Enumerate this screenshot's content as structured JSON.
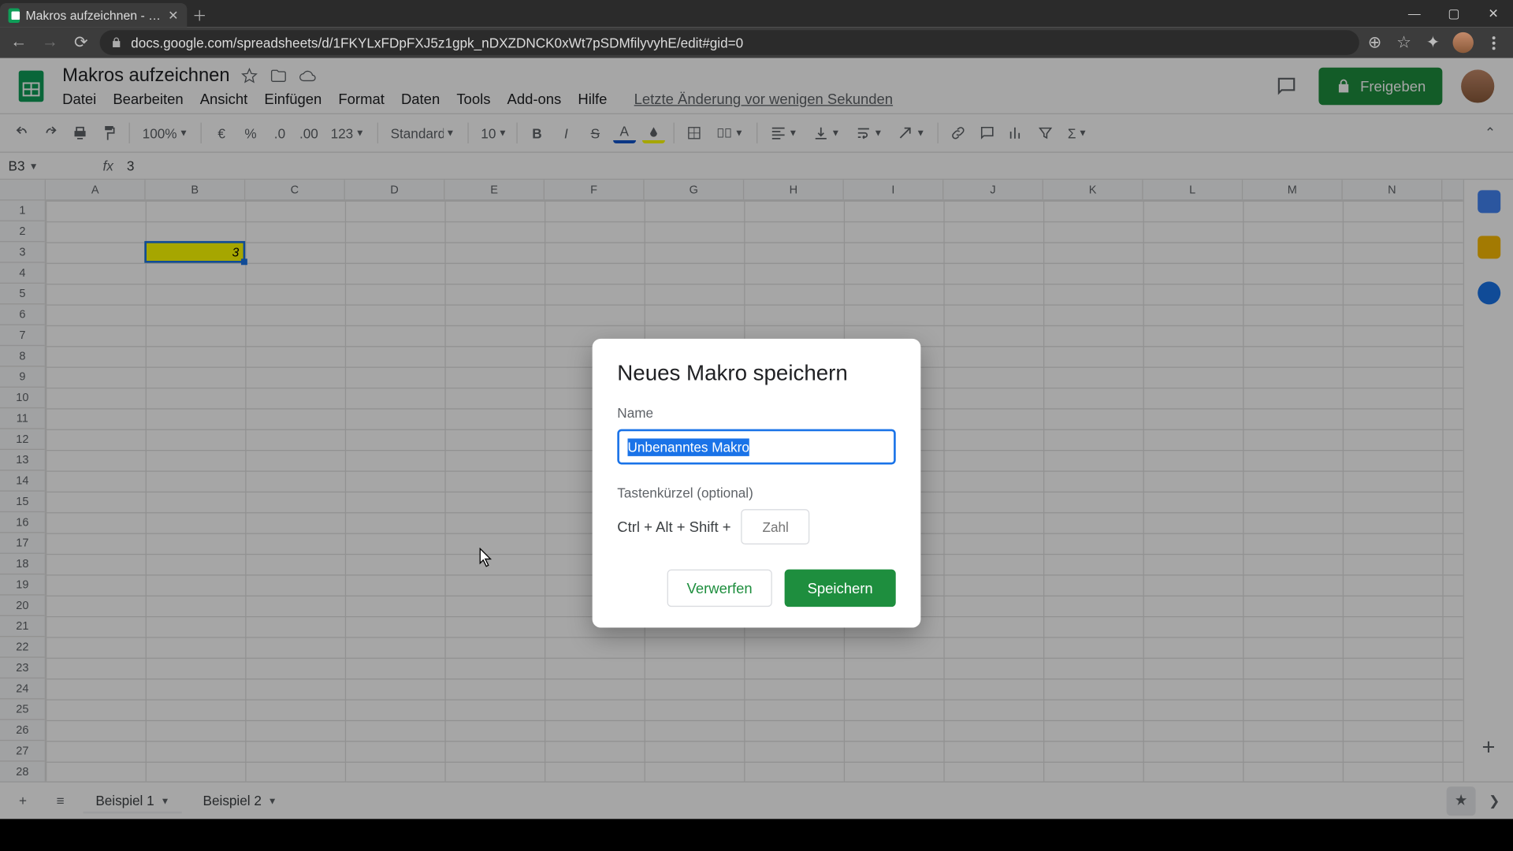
{
  "browser": {
    "tab_title": "Makros aufzeichnen - Google Ta",
    "url": "docs.google.com/spreadsheets/d/1FKYLxFDpFXJ5z1gpk_nDXZDNCK0xWt7pSDMfilyvyhE/edit#gid=0"
  },
  "doc": {
    "title": "Makros aufzeichnen",
    "last_edit": "Letzte Änderung vor wenigen Sekunden"
  },
  "menus": {
    "file": "Datei",
    "edit": "Bearbeiten",
    "view": "Ansicht",
    "insert": "Einfügen",
    "format": "Format",
    "data": "Daten",
    "tools": "Tools",
    "addons": "Add-ons",
    "help": "Hilfe"
  },
  "share": {
    "label": "Freigeben"
  },
  "toolbar": {
    "zoom": "100%",
    "currency": "€",
    "pct": "%",
    "dec_dec": ".0",
    "dec_inc": ".00",
    "num_format": "123",
    "font": "Standard (...",
    "size": "10"
  },
  "namebox": {
    "ref": "B3",
    "formula": "3"
  },
  "columns": [
    "A",
    "B",
    "C",
    "D",
    "E",
    "F",
    "G",
    "H",
    "I",
    "J",
    "K",
    "L",
    "M",
    "N"
  ],
  "rows_count": 28,
  "active_cell": {
    "value": "3"
  },
  "sheets": {
    "tab1": "Beispiel 1",
    "tab2": "Beispiel 2"
  },
  "dialog": {
    "title": "Neues Makro speichern",
    "name_label": "Name",
    "name_value": "Unbenanntes Makro",
    "shortcut_label": "Tastenkürzel (optional)",
    "shortcut_prefix": "Ctrl + Alt + Shift +",
    "shortcut_placeholder": "Zahl",
    "discard": "Verwerfen",
    "save": "Speichern"
  }
}
